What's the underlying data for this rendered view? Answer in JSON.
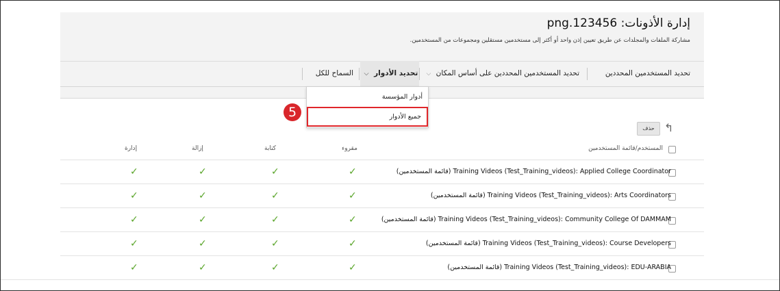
{
  "header": {
    "title": "إدارة الأذونات: png.123456",
    "subtitle": "مشاركة الملفات والمجلدات عن طريق تعيين إذن واحد أو أكثر إلى مستخدمين مستقلين ومجموعات من المستخدمين."
  },
  "tabs": [
    {
      "label": "تحديد المستخدمين المحددين"
    },
    {
      "label": "تحديد المستخدمين المحددين على أساس المكان",
      "chevron": "chevron-down-icon"
    },
    {
      "label": "تحديد الأدوار",
      "chevron": "chevron-down-icon"
    },
    {
      "label": "السماح للكل"
    }
  ],
  "dropdown": {
    "items": [
      {
        "label": "أدوار المؤسسة"
      },
      {
        "label": "جميع الأدوار"
      }
    ]
  },
  "step_badge": "5",
  "toolbar": {
    "delete_label": "حذف",
    "back_icon": "back-arrow-icon"
  },
  "table": {
    "headers": {
      "user": "المستخدم/قائمة المستخدمين",
      "read": "مقروء",
      "write": "كتابة",
      "remove": "إزالة",
      "manage": "إدارة"
    },
    "rows": [
      {
        "label": "Training Videos (Test_Training_videos): Applied College Coordinator (قائمة المستخدمين)",
        "read": true,
        "write": true,
        "remove": true,
        "manage": true
      },
      {
        "label": "Training Videos (Test_Training_videos): Arts Coordinators (قائمة المستخدمين)",
        "read": true,
        "write": true,
        "remove": true,
        "manage": true
      },
      {
        "label": "Training Videos (Test_Training_videos): Community College Of DAMMAM (قائمة المستخدمين)",
        "read": true,
        "write": true,
        "remove": true,
        "manage": true
      },
      {
        "label": "Training Videos (Test_Training_videos): Course Developers (قائمة المستخدمين)",
        "read": true,
        "write": true,
        "remove": true,
        "manage": true
      },
      {
        "label": "Training Videos (Test_Training_videos): EDU-ARABIA (قائمة المستخدمين)",
        "read": true,
        "write": true,
        "remove": true,
        "manage": true
      }
    ]
  },
  "colors": {
    "accent_red": "#e0262a",
    "check_green": "#5aa52a"
  }
}
